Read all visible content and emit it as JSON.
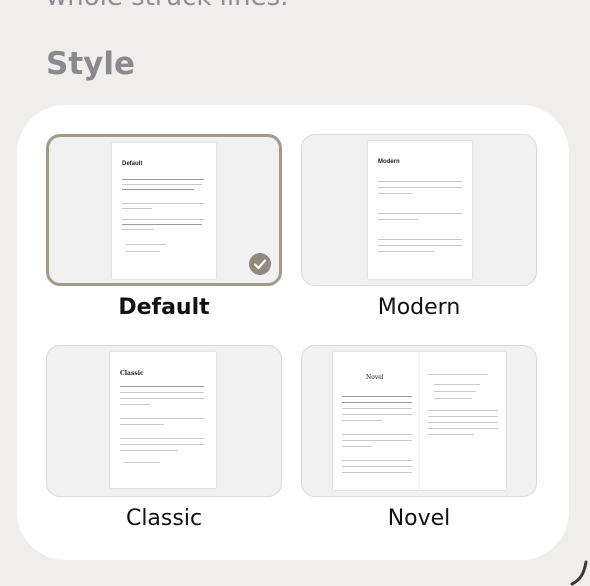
{
  "header": {
    "top_text": "whole struck lines.",
    "section_title": "Style"
  },
  "styles": [
    {
      "label": "Default",
      "page_title": "Default",
      "selected": true
    },
    {
      "label": "Modern",
      "page_title": "Modern",
      "selected": false
    },
    {
      "label": "Classic",
      "page_title": "Classic",
      "selected": false
    },
    {
      "label": "Novel",
      "page_title": "Novel",
      "selected": false
    }
  ],
  "icons": {
    "selected_check": "checkmark-circle-icon"
  },
  "colors": {
    "selection_border": "#a19b8a",
    "check_fill": "#8f8a7c",
    "panel_bg": "#ffffff",
    "page_bg": "#efeeec"
  }
}
